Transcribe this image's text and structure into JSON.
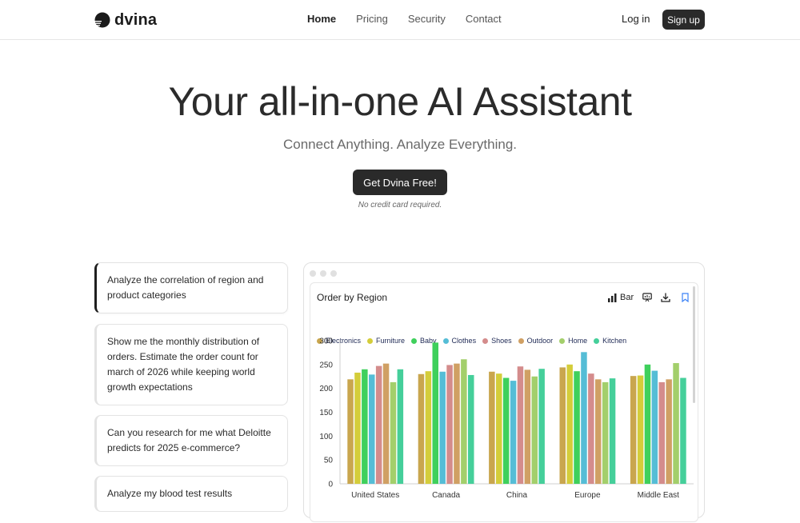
{
  "header": {
    "brand": "dvina",
    "nav": [
      "Home",
      "Pricing",
      "Security",
      "Contact"
    ],
    "login": "Log in",
    "signup": "Sign up"
  },
  "hero": {
    "title": "Your all-in-one AI Assistant",
    "subtitle": "Connect Anything. Analyze Everything.",
    "cta": "Get Dvina Free!",
    "note": "No credit card required."
  },
  "prompts": [
    "Analyze the correlation of region and product categories",
    "Show me the monthly distribution of orders. Estimate the order count for march of 2026 while keeping world growth expectations",
    "Can you research for me what Deloitte predicts for 2025 e-commerce?",
    "Analyze my blood test results"
  ],
  "panel": {
    "title": "Order by Region",
    "chart_type_label": "Bar"
  },
  "colors": {
    "accent": "#2a2a2a",
    "series": [
      "#c9a64e",
      "#d4cd3a",
      "#3fd05c",
      "#55bdd6",
      "#d48c8c",
      "#d0a064",
      "#a3cf6b",
      "#45cf9a"
    ]
  },
  "chart_data": {
    "type": "bar",
    "title": "Order by Region",
    "categories": [
      "United States",
      "Canada",
      "China",
      "Europe",
      "Middle East"
    ],
    "series": [
      {
        "name": "Electronics",
        "values": [
          219,
          230,
          235,
          244,
          226
        ]
      },
      {
        "name": "Furniture",
        "values": [
          233,
          236,
          231,
          250,
          227
        ]
      },
      {
        "name": "Baby",
        "values": [
          240,
          296,
          222,
          236,
          250
        ]
      },
      {
        "name": "Clothes",
        "values": [
          229,
          235,
          216,
          276,
          237
        ]
      },
      {
        "name": "Shoes",
        "values": [
          247,
          249,
          246,
          231,
          213
        ]
      },
      {
        "name": "Outdoor",
        "values": [
          252,
          252,
          239,
          219,
          219
        ]
      },
      {
        "name": "Home",
        "values": [
          213,
          261,
          225,
          213,
          253
        ]
      },
      {
        "name": "Kitchen",
        "values": [
          240,
          228,
          241,
          221,
          222
        ]
      }
    ],
    "yticks": [
      "300",
      "250",
      "200",
      "150",
      "100",
      "50",
      "0"
    ],
    "ylim": [
      0,
      300
    ],
    "legend_position": "top-left",
    "grid": false
  }
}
